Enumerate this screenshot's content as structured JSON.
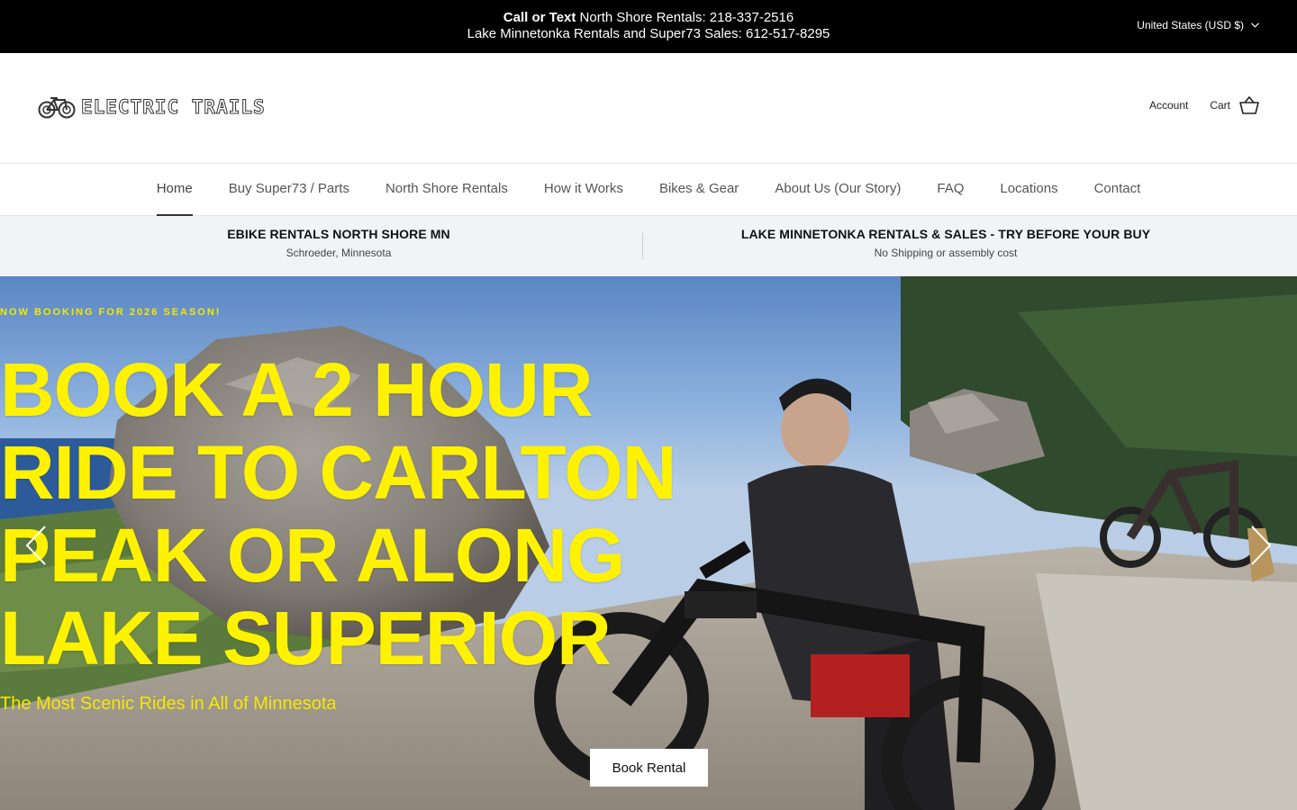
{
  "announcement": {
    "line1_bold": "Call or Text",
    "line1_rest": " North Shore Rentals: 218-337-2516",
    "line2": "Lake Minnetonka Rentals and Super73 Sales: 612-517-8295",
    "currency": "United States (USD $)"
  },
  "header": {
    "logo_text": "ELECTRIC TRAILS",
    "account_label": "Account",
    "cart_label": "Cart"
  },
  "nav": {
    "items": [
      {
        "label": "Home"
      },
      {
        "label": "Buy Super73 / Parts"
      },
      {
        "label": "North Shore Rentals"
      },
      {
        "label": "How it Works"
      },
      {
        "label": "Bikes & Gear"
      },
      {
        "label": "About Us (Our Story)"
      },
      {
        "label": "FAQ"
      },
      {
        "label": "Locations"
      },
      {
        "label": "Contact"
      }
    ],
    "active_index": 0
  },
  "strip": {
    "items": [
      {
        "title": "EBIKE RENTALS NORTH SHORE MN",
        "subtitle": "Schroeder, Minnesota"
      },
      {
        "title": "LAKE MINNETONKA RENTALS & SALES - TRY BEFORE YOUR BUY",
        "subtitle": "No Shipping or assembly cost"
      }
    ]
  },
  "hero": {
    "eyebrow": "NOW BOOKING FOR 2026 SEASON!",
    "headline_lines": [
      "BOOK A 2 HOUR",
      "RIDE TO CARLTON",
      "PEAK OR ALONG",
      "LAKE SUPERIOR"
    ],
    "subhead": "The Most Scenic Rides in All of Minnesota",
    "cta_label": "Book Rental"
  },
  "colors": {
    "announcement_bg": "#000000",
    "hero_text": "#fff200",
    "strip_bg": "#f2f3f4"
  }
}
